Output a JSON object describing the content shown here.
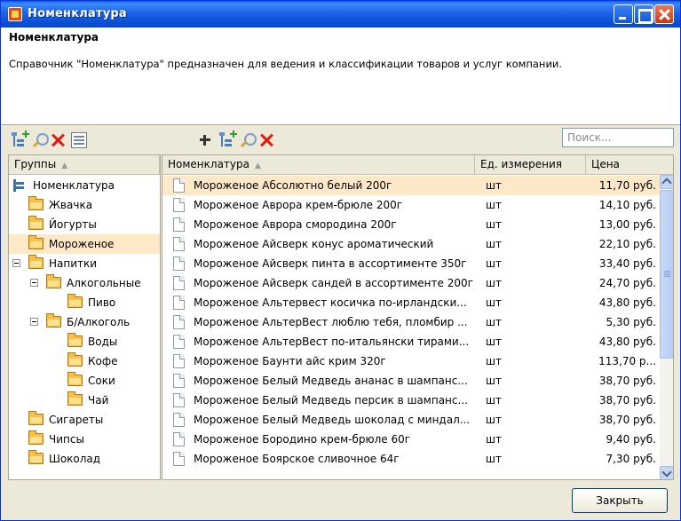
{
  "window": {
    "title": "Номенклатура"
  },
  "header": {
    "title": "Номенклатура",
    "description": "Справочник \"Номенклатура\" предназначен для ведения и классификации товаров и услуг компании."
  },
  "search": {
    "placeholder": "Поиск..."
  },
  "groups": {
    "header": "Группы",
    "items": [
      {
        "label": "Номенклатура",
        "level": 0,
        "icon": "root-icon"
      },
      {
        "label": "Жвачка",
        "level": 1,
        "icon": "folder-icon"
      },
      {
        "label": "Йогурты",
        "level": 1,
        "icon": "folder-icon"
      },
      {
        "label": "Мороженое",
        "level": 1,
        "icon": "folder-icon",
        "selected": true
      },
      {
        "label": "Напитки",
        "level": 1,
        "icon": "folder-icon",
        "expanded": true
      },
      {
        "label": "Алкогольные",
        "level": 2,
        "icon": "folder-icon",
        "expanded": true
      },
      {
        "label": "Пиво",
        "level": 3,
        "icon": "folder-icon"
      },
      {
        "label": "Б/Алкоголь",
        "level": 2,
        "icon": "folder-icon",
        "expanded": true
      },
      {
        "label": "Воды",
        "level": 3,
        "icon": "folder-icon"
      },
      {
        "label": "Кофе",
        "level": 3,
        "icon": "folder-icon"
      },
      {
        "label": "Соки",
        "level": 3,
        "icon": "folder-icon"
      },
      {
        "label": "Чай",
        "level": 3,
        "icon": "folder-icon"
      },
      {
        "label": "Сигареты",
        "level": 1,
        "icon": "folder-icon"
      },
      {
        "label": "Чипсы",
        "level": 1,
        "icon": "folder-icon"
      },
      {
        "label": "Шоколад",
        "level": 1,
        "icon": "folder-icon"
      }
    ]
  },
  "table": {
    "columns": {
      "name": "Номенклатура",
      "unit": "Ед. измерения",
      "price": "Цена"
    },
    "rows": [
      {
        "name": "Мороженое Абсолютно белый 200г",
        "unit": "шт",
        "price": "11,70 руб.",
        "selected": true
      },
      {
        "name": "Мороженое Аврора крем-брюле 200г",
        "unit": "шт",
        "price": "14,10 руб."
      },
      {
        "name": "Мороженое Аврора смородина 200г",
        "unit": "шт",
        "price": "13,00 руб."
      },
      {
        "name": "Мороженое Айсверк конус ароматический",
        "unit": "шт",
        "price": "22,10 руб."
      },
      {
        "name": "Мороженое Айсверк пинта в ассортименте 350г",
        "unit": "шт",
        "price": "33,40 руб."
      },
      {
        "name": "Мороженое Айсверк сандей в ассортименте 200г",
        "unit": "шт",
        "price": "24,70 руб."
      },
      {
        "name": "Мороженое Альтервест косичка по-ирландски...",
        "unit": "шт",
        "price": "43,80 руб."
      },
      {
        "name": "Мороженое АльтерВест люблю тебя, пломбир ...",
        "unit": "шт",
        "price": "5,30 руб."
      },
      {
        "name": "Мороженое АльтерВест по-итальянски тирами...",
        "unit": "шт",
        "price": "43,80 руб."
      },
      {
        "name": "Мороженое Баунти айс крим 320г",
        "unit": "шт",
        "price": "113,70 р..."
      },
      {
        "name": "Мороженое Белый Медведь ананас в шампанс...",
        "unit": "шт",
        "price": "38,70 руб."
      },
      {
        "name": "Мороженое Белый Медведь персик в шампанс...",
        "unit": "шт",
        "price": "38,70 руб."
      },
      {
        "name": "Мороженое Белый Медведь шоколад с миндал...",
        "unit": "шт",
        "price": "38,70 руб."
      },
      {
        "name": "Мороженое Бородино крем-брюле 60г",
        "unit": "шт",
        "price": "9,40 руб."
      },
      {
        "name": "Мороженое Боярское сливочное 64г",
        "unit": "шт",
        "price": "7,30 руб."
      }
    ]
  },
  "footer": {
    "close_label": "Закрыть"
  }
}
